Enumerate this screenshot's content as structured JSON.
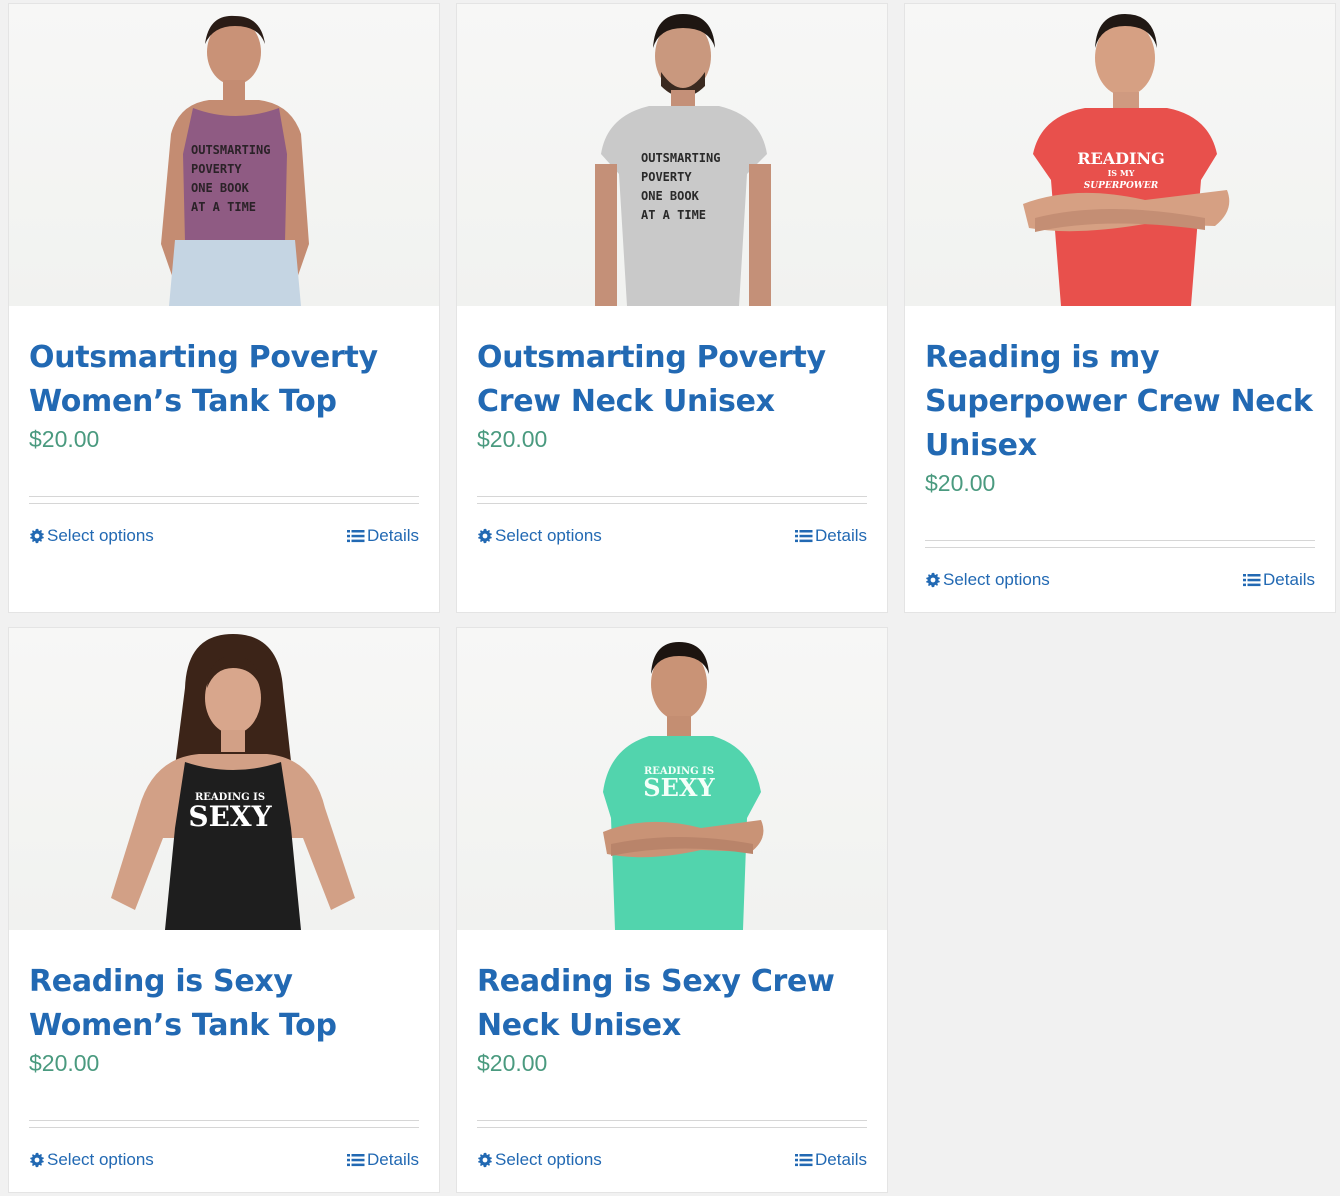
{
  "products": [
    {
      "title": "Outsmarting Poverty Women’s Tank Top",
      "price": "$20.00",
      "shirt_text": [
        "OUTSMARTING",
        "POVERTY",
        "ONE BOOK",
        "AT A TIME"
      ],
      "shirt_color": "#8f5b83",
      "shirt_ink": "#2b2228"
    },
    {
      "title": "Outsmarting Poverty Crew Neck Unisex",
      "price": "$20.00",
      "shirt_text": [
        "OUTSMARTING",
        "POVERTY",
        "ONE BOOK",
        "AT A TIME"
      ],
      "shirt_color": "#c9c9c9",
      "shirt_ink": "#2a2a2a"
    },
    {
      "title": "Reading is my Superpower Crew Neck Unisex",
      "price": "$20.00",
      "shirt_text": [
        "READING",
        "IS MY",
        "SUPERPOWER"
      ],
      "shirt_color": "#e8504c",
      "shirt_ink": "#ffffff"
    },
    {
      "title": "Reading is Sexy Women’s Tank Top",
      "price": "$20.00",
      "shirt_text": [
        "READING IS",
        "SEXY"
      ],
      "shirt_color": "#1e1e1e",
      "shirt_ink": "#ffffff"
    },
    {
      "title": "Reading is Sexy Crew Neck Unisex",
      "price": "$20.00",
      "shirt_text": [
        "READING IS",
        "SEXY"
      ],
      "shirt_color": "#52d4ad",
      "shirt_ink": "#f4fff9"
    }
  ],
  "actions": {
    "select_options_label": "Select options",
    "details_label": "Details",
    "select_icon": "gear-icon",
    "details_icon": "list-icon"
  },
  "colors": {
    "title": "#2269b3",
    "price": "#4a9a7f",
    "link": "#2269b3",
    "page_bg": "#f1f1f1",
    "card_bg": "#ffffff"
  }
}
